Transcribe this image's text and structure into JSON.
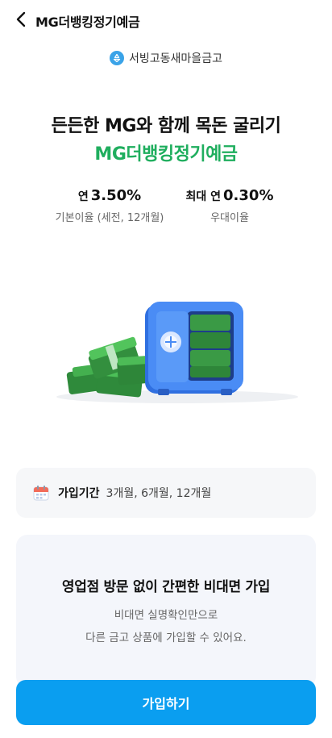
{
  "header": {
    "title": "MG더뱅킹정기예금",
    "back_icon": "chevron-left-icon"
  },
  "branch": {
    "name": "서빙고동새마을금고",
    "icon": "recycle-icon",
    "icon_color": "#3aa3e8"
  },
  "hero": {
    "headline": "든든한 MG와 함께 목돈 굴리기",
    "product_name": "MG더뱅킹정기예금",
    "product_color": "#1fae5e"
  },
  "rates": {
    "base": {
      "prefix": "연",
      "value": "3.50%",
      "caption": "기본이율 (세전, 12개월)"
    },
    "bonus": {
      "prefix": "최대 연",
      "value": "0.30%",
      "caption": "우대이율"
    }
  },
  "period": {
    "label": "가입기간",
    "value": "3개월, 6개월, 12개월",
    "icon": "calendar-icon"
  },
  "info": {
    "title": "영업점 방문 없이 간편한 비대면 가입",
    "line1": "비대면 실명확인만으로",
    "line2": "다른 금고 상품에 가입할 수 있어요."
  },
  "cta": {
    "label": "가입하기",
    "color": "#0a9ef0"
  }
}
